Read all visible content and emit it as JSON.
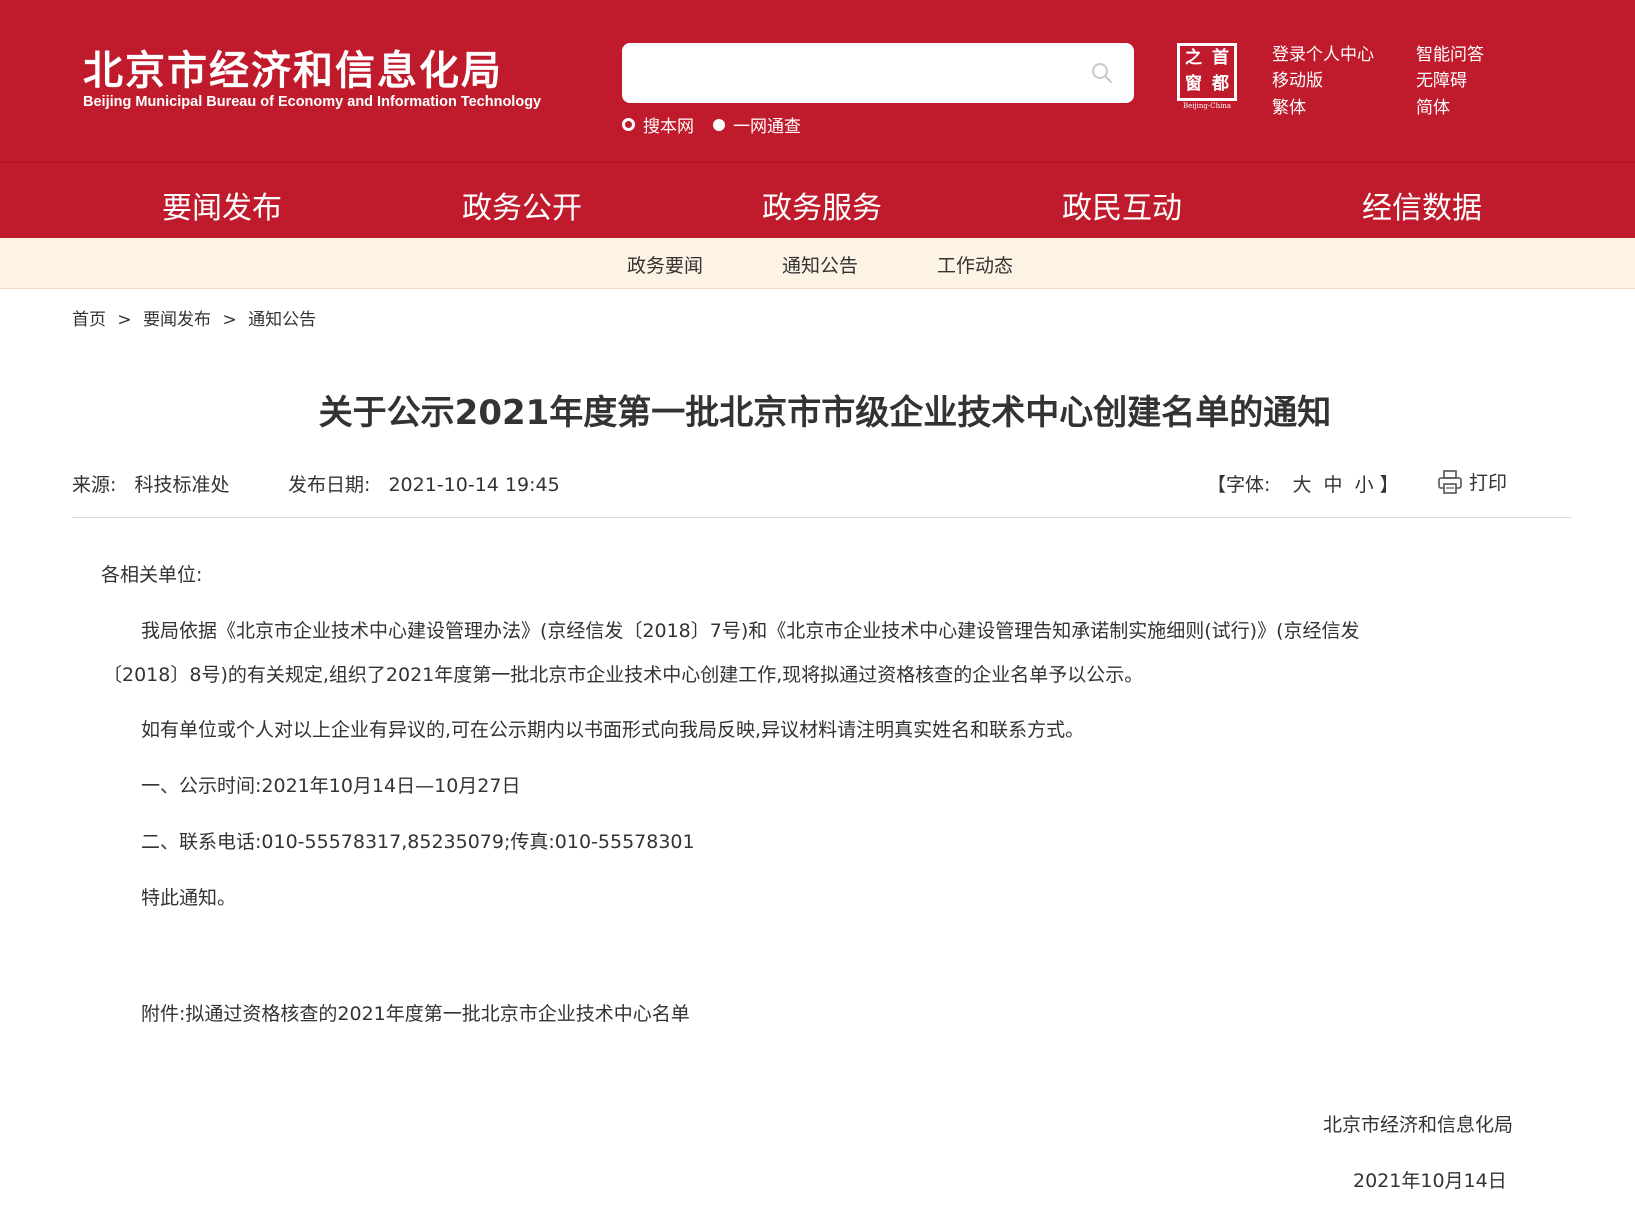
{
  "header": {
    "logo_cn": "北京市经济和信息化局",
    "logo_en": "Beijing Municipal Bureau of Economy and Information Technology",
    "search": {
      "placeholder": "",
      "scope_options": [
        "搜本网",
        "一网通查"
      ]
    },
    "capital_badge": {
      "chars": [
        "之",
        "首",
        "窗",
        "都"
      ],
      "caption": "Beijing-China"
    },
    "links": [
      "登录个人中心",
      "移动版",
      "繁体",
      "智能问答",
      "无障碍",
      "简体"
    ]
  },
  "nav": {
    "items": [
      "要闻发布",
      "政务公开",
      "政务服务",
      "政民互动",
      "经信数据"
    ],
    "active": "要闻发布"
  },
  "subnav": {
    "items": [
      "政务要闻",
      "通知公告",
      "工作动态"
    ]
  },
  "breadcrumb": [
    "首页",
    "要闻发布",
    "通知公告"
  ],
  "breadcrumb_sep": ">",
  "article": {
    "title": "关于公示2021年度第一批北京市市级企业技术中心创建名单的通知",
    "source_label": "来源:",
    "source": "科技标准处",
    "date_label": "发布日期:",
    "date": "2021-10-14 19:45",
    "font_label": "【字体:",
    "font_sizes": [
      "大",
      "中",
      "小"
    ],
    "font_close": "】",
    "print_label": "打印",
    "salutation": "各相关单位:",
    "para1_line1": "我局依据《北京市企业技术中心建设管理办法》(京经信发〔2018〕7号)和《北京市企业技术中心建设管理告知承诺制实施细则(试行)》(京经信发",
    "para1_line2": "〔2018〕8号)的有关规定,组织了2021年度第一批北京市企业技术中心创建工作,现将拟通过资格核查的企业名单予以公示。",
    "para2": "如有单位或个人对以上企业有异议的,可在公示期内以书面形式向我局反映,异议材料请注明真实姓名和联系方式。",
    "para3": "一、公示时间:2021年10月14日—10月27日",
    "para4": "二、联系电话:010-55578317,85235079;传真:010-55578301",
    "para5": "特此通知。",
    "attachment": "附件:拟通过资格核查的2021年度第一批北京市企业技术中心名单",
    "signature": "北京市经济和信息化局",
    "sign_date": "2021年10月14日"
  },
  "colors": {
    "brand_red": "#bf1b2c",
    "subnav_bg": "#fdf3e5",
    "active_underline": "#f6c59b"
  }
}
